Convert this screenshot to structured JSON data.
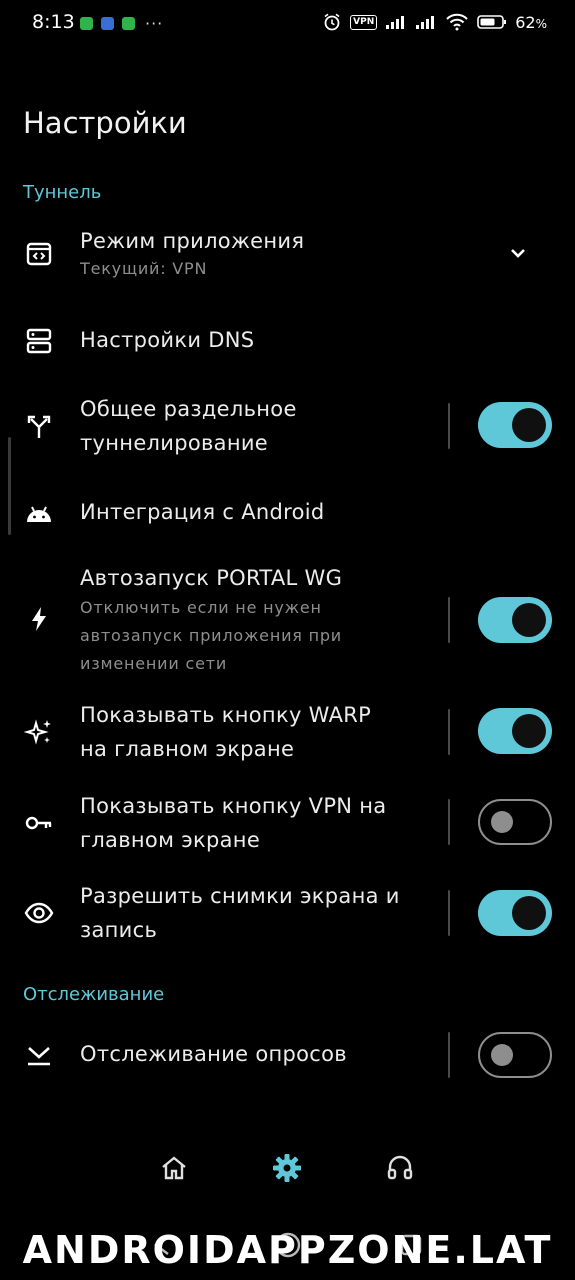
{
  "status_bar": {
    "time": "8:13",
    "vpn_label": "VPN",
    "battery_percent": "62",
    "battery_unit": "%",
    "more_dots": "···"
  },
  "page": {
    "title": "Настройки"
  },
  "sections": {
    "tunnel": "Туннель",
    "tracking": "Отслеживание"
  },
  "settings": {
    "app_mode": {
      "title": "Режим приложения",
      "subtitle": "Текущий: VPN"
    },
    "dns": {
      "title": "Настройки DNS"
    },
    "split_tunnel": {
      "title_line1": "Общее раздельное",
      "title_line2": "туннелирование",
      "enabled": true
    },
    "android_integration": {
      "title": "Интеграция с Android"
    },
    "autostart": {
      "title": "Автозапуск PORTAL WG",
      "sub_line1": "Отключить если не нужен",
      "sub_line2": "автозапуск приложения при",
      "sub_line3": "изменении сети",
      "enabled": true
    },
    "warp_button": {
      "title_line1": "Показывать кнопку WARP",
      "title_line2": "на главном экране",
      "enabled": true
    },
    "vpn_button": {
      "title_line1": "Показывать кнопку VPN на",
      "title_line2": "главном экране",
      "enabled": false
    },
    "screenshots": {
      "title_line1": "Разрешить снимки экрана и",
      "title_line2": "запись",
      "enabled": true
    },
    "poll_tracking": {
      "title": "Отслеживание опросов",
      "enabled": false
    }
  },
  "colors": {
    "accent": "#5ec8d8",
    "background": "#000000",
    "subtitle": "#8e8e8e"
  },
  "bottom_nav": {
    "items": [
      {
        "icon": "home-icon",
        "active": false
      },
      {
        "icon": "gear-icon",
        "active": true
      },
      {
        "icon": "headset-icon",
        "active": false
      }
    ]
  },
  "watermark": "ANDROIDAPPZONE.LAT"
}
